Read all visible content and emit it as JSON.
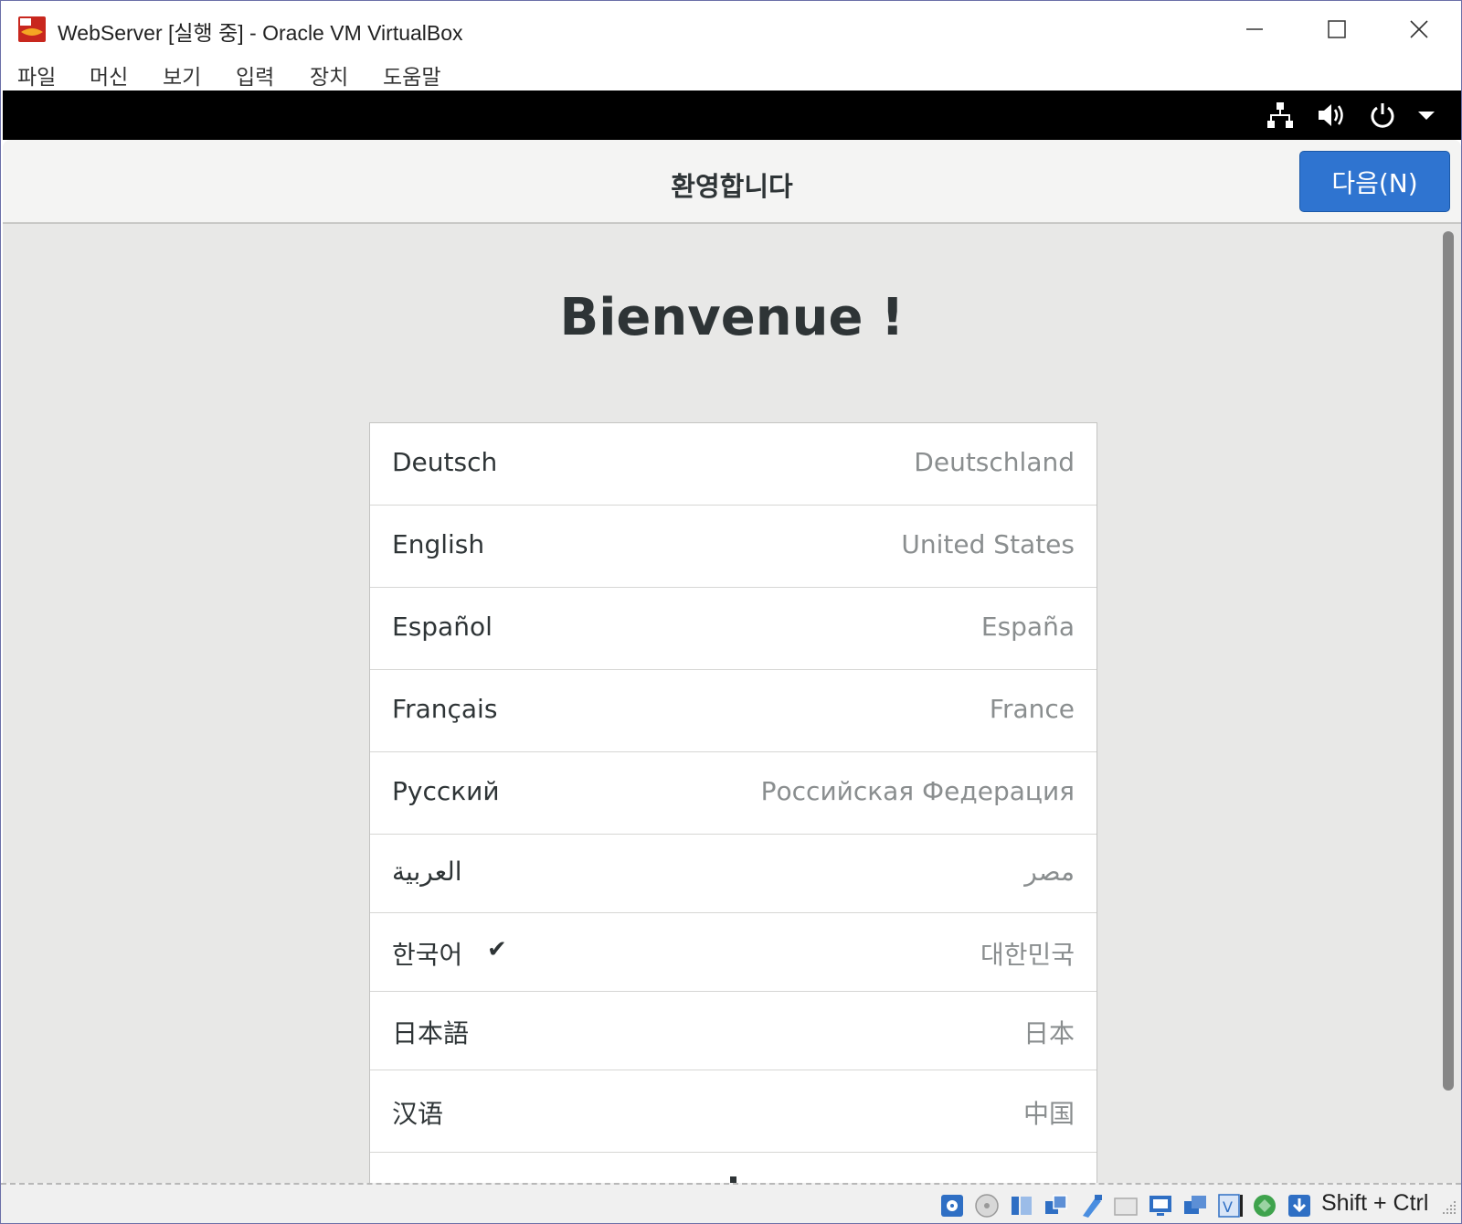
{
  "window": {
    "title": "WebServer [실행 중] - Oracle VM VirtualBox",
    "controls": {
      "minimize_icon": "minimize-icon",
      "maximize_icon": "maximize-icon",
      "close_icon": "close-icon"
    }
  },
  "menu": {
    "items": [
      "파일",
      "머신",
      "보기",
      "입력",
      "장치",
      "도움말"
    ]
  },
  "guest_topbar": {
    "icons": [
      "network-icon",
      "volume-icon",
      "power-icon",
      "dropdown-arrow-icon"
    ]
  },
  "header": {
    "title": "환영합니다",
    "next_label": "다음(N)"
  },
  "content": {
    "welcome": "Bienvenue !",
    "languages": [
      {
        "name": "Deutsch",
        "region": "Deutschland",
        "selected": false
      },
      {
        "name": "English",
        "region": "United States",
        "selected": false
      },
      {
        "name": "Español",
        "region": "España",
        "selected": false
      },
      {
        "name": "Français",
        "region": "France",
        "selected": false
      },
      {
        "name": "Русский",
        "region": "Российская Федерация",
        "selected": false
      },
      {
        "name": "العربية",
        "region": "مصر",
        "selected": false
      },
      {
        "name": "한국어",
        "region": "대한민국",
        "selected": true
      },
      {
        "name": "日本語",
        "region": "日本",
        "selected": false
      },
      {
        "name": "汉语",
        "region": "中国",
        "selected": false
      }
    ]
  },
  "statusbar": {
    "host_key": "Shift + Ctrl",
    "icons": [
      "hard-disk-icon",
      "optical-drive-icon",
      "audio-icon",
      "network-adapters-icon",
      "usb-icon",
      "shared-folders-icon",
      "display-icon",
      "recording-icon",
      "cpu-vt-x-icon",
      "mouse-integration-icon",
      "keyboard-capture-icon"
    ]
  }
}
